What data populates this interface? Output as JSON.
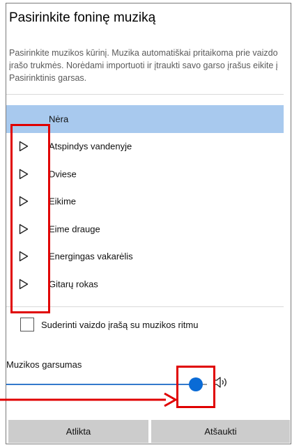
{
  "dialog": {
    "title": "Pasirinkite foninę muziką",
    "description": "Pasirinkite muzikos kūrinį. Muzika automatiškai pritaikoma prie vaizdo įrašo trukmės. Norėdami importuoti ir įtraukti savo garso įrašus eikite į Pasirinktinis garsas."
  },
  "music_list": {
    "items": [
      {
        "label": "Nėra",
        "selected": true,
        "icon": null
      },
      {
        "label": "Atspindys vandenyje",
        "selected": false,
        "icon": "play-icon"
      },
      {
        "label": "Dviese",
        "selected": false,
        "icon": "play-icon"
      },
      {
        "label": "Eikime",
        "selected": false,
        "icon": "play-icon"
      },
      {
        "label": "Eime drauge",
        "selected": false,
        "icon": "play-icon"
      },
      {
        "label": "Energingas vakarėlis",
        "selected": false,
        "icon": "play-icon"
      },
      {
        "label": "Gitarų rokas",
        "selected": false,
        "icon": "play-icon"
      }
    ]
  },
  "sync_option": {
    "label": "Suderinti vaizdo įrašą su muzikos ritmu",
    "checked": false
  },
  "volume": {
    "label": "Muzikos garsumas",
    "level_fraction": 0.945,
    "icon": "speaker-icon"
  },
  "buttons": {
    "done_label": "Atlikta",
    "cancel_label": "Atšaukti"
  },
  "colors": {
    "selection": "#a8c9ee",
    "accent": "#0a6bd6",
    "annotation": "#e00000",
    "button_bg": "#cccccc"
  }
}
